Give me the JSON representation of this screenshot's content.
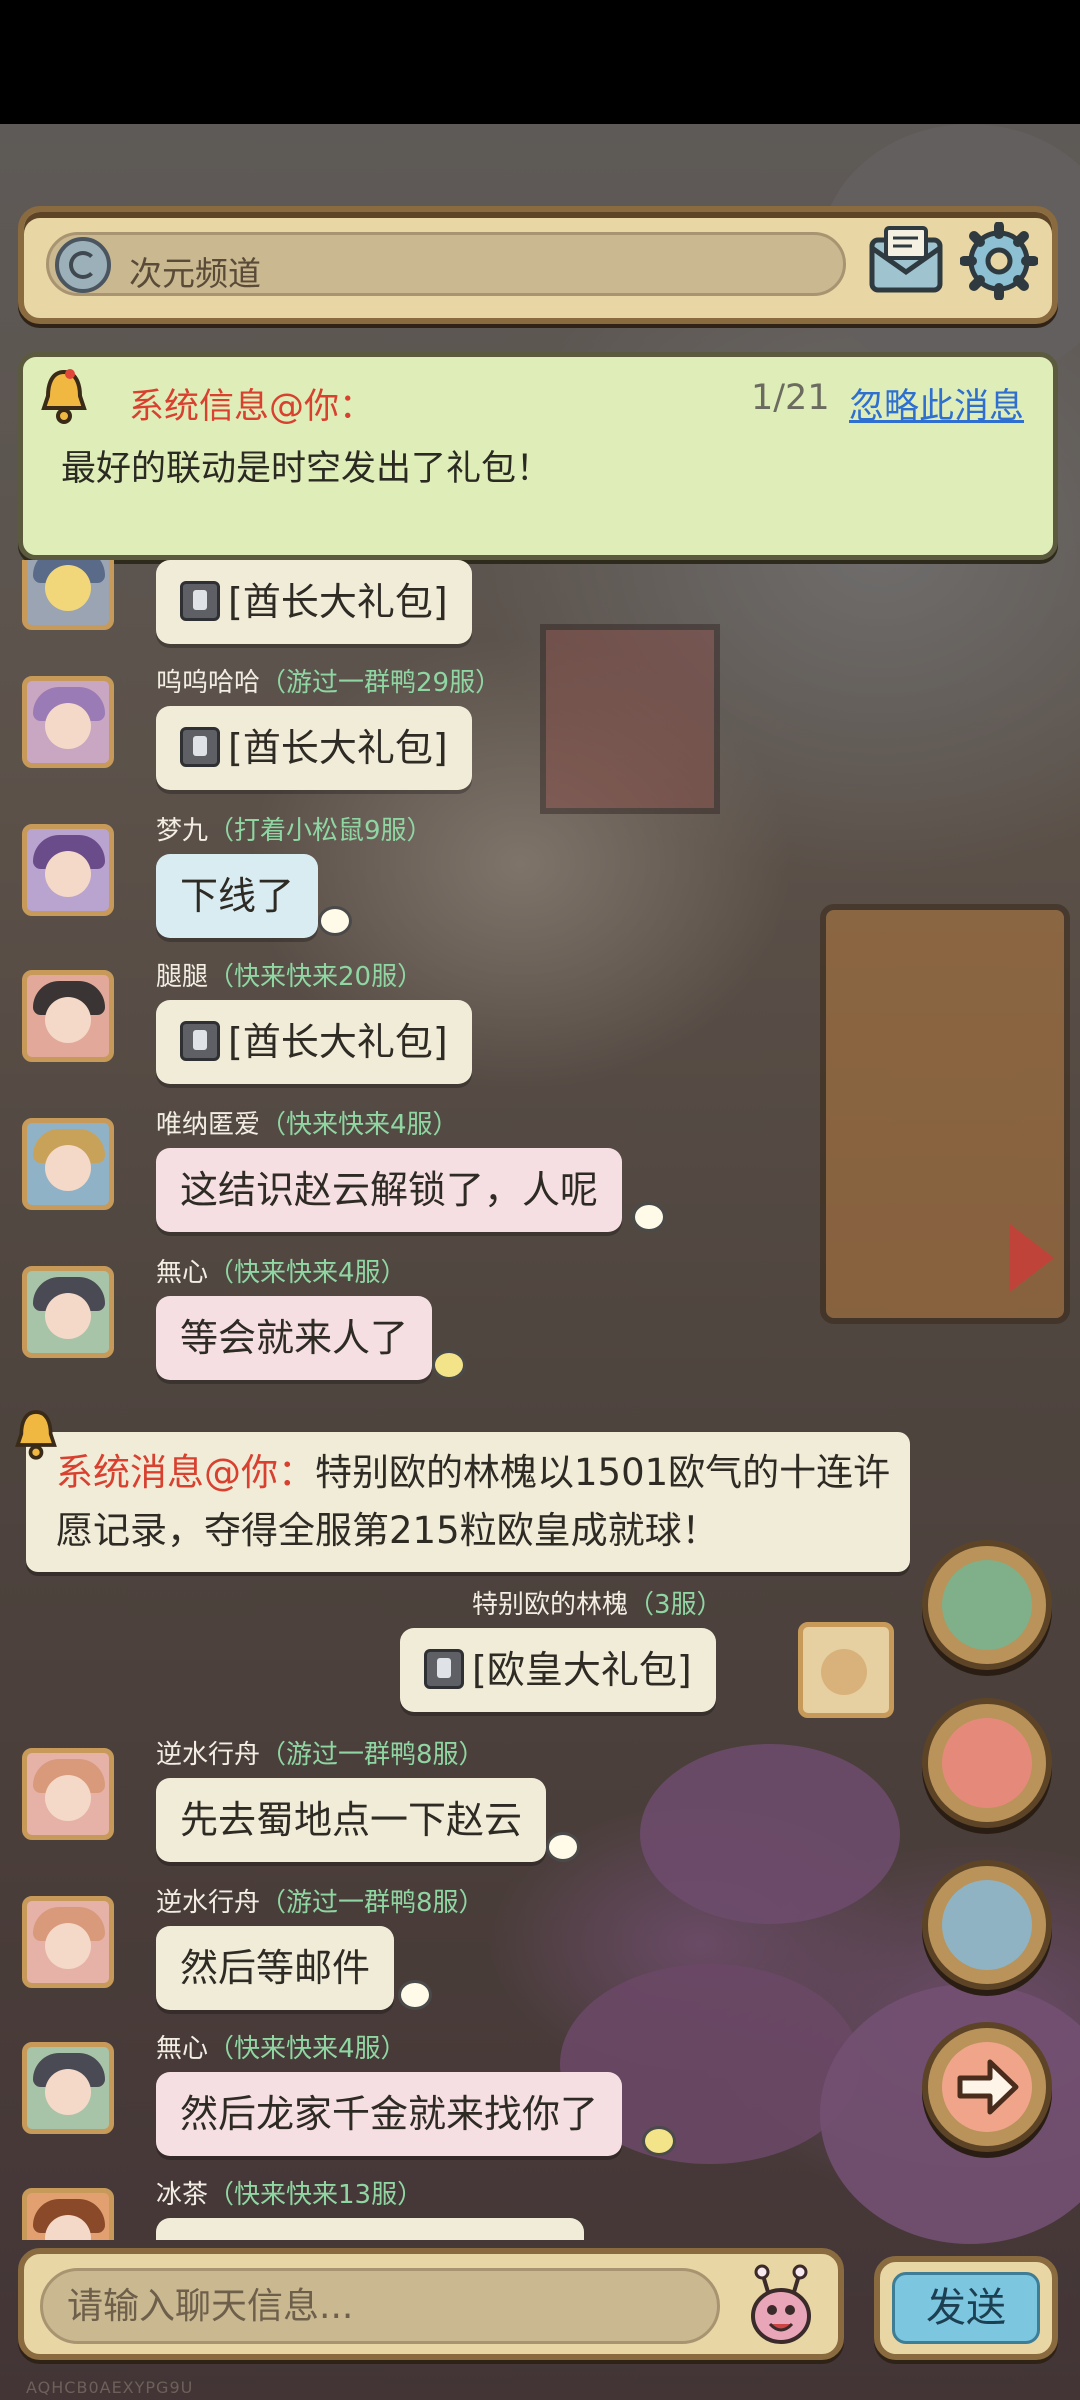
{
  "top_bar": {
    "channel_name": "次元频道"
  },
  "system_notice": {
    "title": "系统信息@你：",
    "count": "1/21",
    "ignore_label": "忽略此消息",
    "body": "最好的联动是时空发出了礼包！"
  },
  "messages": [
    {
      "sender": "",
      "server": "",
      "text": "[酋长大礼包]"
    },
    {
      "sender": "呜呜哈哈",
      "server": "（游过一群鸭29服）",
      "text": "[酋长大礼包]"
    },
    {
      "sender": "梦九",
      "server": "（打着小松鼠9服）",
      "text": "下线了"
    },
    {
      "sender": "腿腿",
      "server": "（快来快来20服）",
      "text": "[酋长大礼包]"
    },
    {
      "sender": "唯纳匿爱",
      "server": "（快来快来4服）",
      "text": "这结识赵云解锁了，人呢"
    },
    {
      "sender": "無心",
      "server": "（快来快来4服）",
      "text": "等会就来人了"
    },
    {
      "sender": "特别欧的林槐",
      "server": "（3服）",
      "text": "[欧皇大礼包]"
    },
    {
      "sender": "逆水行舟",
      "server": "（游过一群鸭8服）",
      "text": "先去蜀地点一下赵云"
    },
    {
      "sender": "逆水行舟",
      "server": "（游过一群鸭8服）",
      "text": "然后等邮件"
    },
    {
      "sender": "無心",
      "server": "（快来快来4服）",
      "text": "然后龙家千金就来找你了"
    },
    {
      "sender": "冰茶",
      "server": "（快来快来13服）",
      "text": ""
    }
  ],
  "system_message": {
    "prefix": "系统消息@你：",
    "body": "特别欧的林槐以1501欧气的十连许愿记录，夺得全服第215粒欧皇成就球！"
  },
  "input": {
    "placeholder": "请输入聊天信息..."
  },
  "send_label": "发送",
  "watermark": "AQHCB0AEXYPG9U",
  "icons": {
    "channel": "portal-icon",
    "mail": "mail-icon",
    "settings": "gear-icon",
    "bell": "bell-icon",
    "gift": "gift-icon",
    "emoji": "bug-face-icon"
  },
  "colors": {
    "panel": "#e8d6a4",
    "notice_bg": "#dfeeb8",
    "alert_red": "#d8402f",
    "link_blue": "#2e6fd0",
    "server_green": "#8fd6a3",
    "send_blue": "#7cc6e0"
  }
}
